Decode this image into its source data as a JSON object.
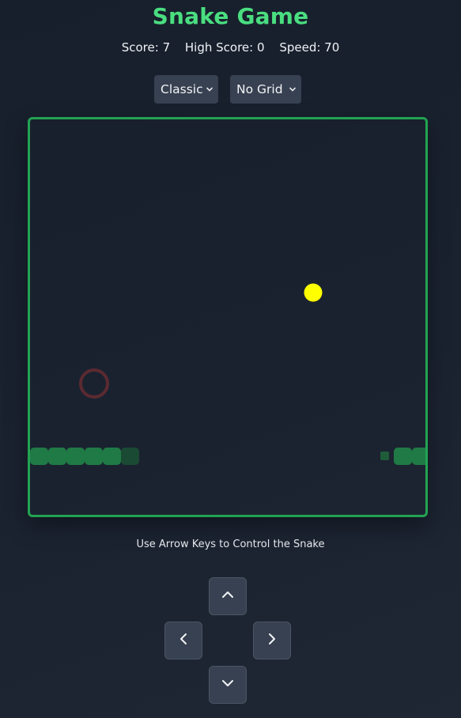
{
  "title": "Snake Game",
  "stats": {
    "score": "Score: 7",
    "high_score": "High Score: 0",
    "speed": "Speed: 70"
  },
  "selects": {
    "mode": "Classic",
    "grid": "No Grid"
  },
  "hint": "Use Arrow Keys to Control the Snake",
  "controls": {
    "up_icon": "chevron-up-icon",
    "left_icon": "chevron-left-icon",
    "right_icon": "chevron-right-icon",
    "down_icon": "chevron-down-icon"
  },
  "colors": {
    "accent": "#4ade80",
    "board_border": "#22a352",
    "snake": "#1f7a45",
    "food": "#ffff00",
    "obstacle_ring": "#5b2a30",
    "button_bg": "#374151"
  }
}
